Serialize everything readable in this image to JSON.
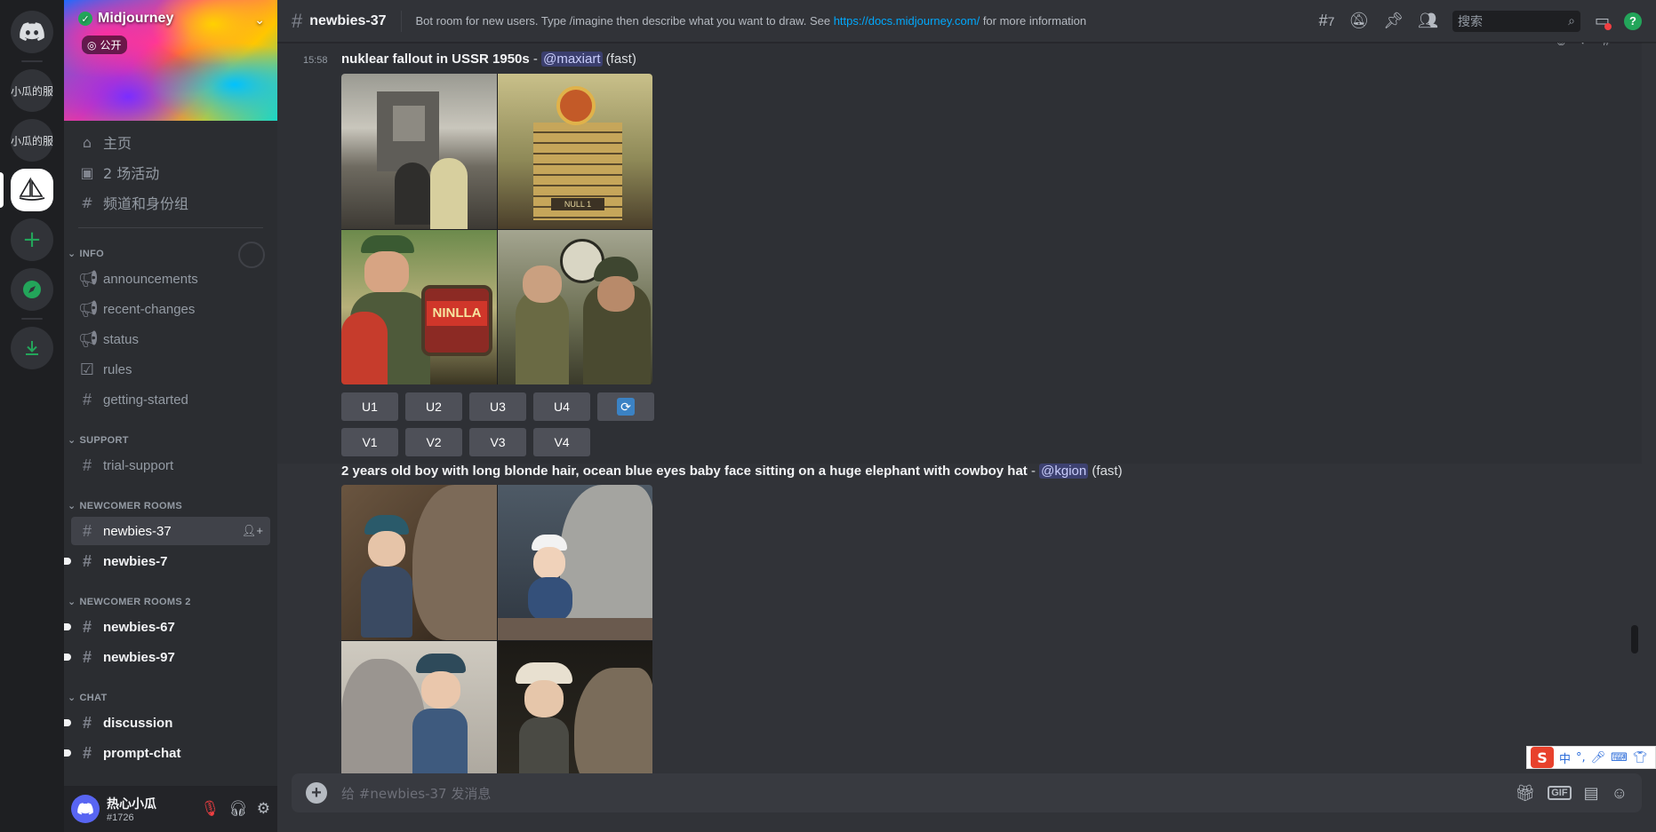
{
  "server_rail": {
    "items": [
      {
        "label": "小瓜的服"
      },
      {
        "label": "小瓜的服"
      }
    ]
  },
  "server": {
    "name": "Midjourney",
    "badge": "公开"
  },
  "nav": [
    {
      "icon": "home-icon",
      "label": "主页"
    },
    {
      "icon": "calendar-icon",
      "label": "2 场活动"
    },
    {
      "icon": "channels-roles-icon",
      "label": "频道和身份组"
    }
  ],
  "categories": {
    "info": "INFO",
    "support": "SUPPORT",
    "newcomer": "NEWCOMER ROOMS",
    "newcomer2": "NEWCOMER ROOMS 2",
    "chat": "CHAT"
  },
  "channels": {
    "info": [
      "announcements",
      "recent-changes",
      "status",
      "rules",
      "getting-started"
    ],
    "support": [
      "trial-support"
    ],
    "newcomer": [
      "newbies-37",
      "newbies-7"
    ],
    "newcomer2": [
      "newbies-67",
      "newbies-97"
    ],
    "chat": [
      "discussion",
      "prompt-chat"
    ]
  },
  "header": {
    "channel": "newbies-37",
    "topic_prefix": "Bot room for new users. Type /imagine then describe what you want to draw. See ",
    "topic_link": "https://docs.midjourney.com/",
    "topic_suffix": " for more information",
    "threads_count": "7",
    "search_placeholder": "搜索"
  },
  "messages": [
    {
      "time": "15:58",
      "prompt": "nuklear fallout in USSR 1950s",
      "sep": " - ",
      "mention": "@maxiart",
      "speed": " (fast)",
      "upscale_buttons": [
        "U1",
        "U2",
        "U3",
        "U4"
      ],
      "variation_buttons": [
        "V1",
        "V2",
        "V3",
        "V4"
      ],
      "sign_text": "NINLLA",
      "building_text": "NULL 1"
    },
    {
      "prompt": "2 years old boy with long blonde hair, ocean blue eyes baby face sitting on a huge elephant with cowboy hat",
      "sep": " - ",
      "mention": "@kgion",
      "speed": " (fast)"
    }
  ],
  "composer": {
    "placeholder": "给 #newbies-37 发消息"
  },
  "user": {
    "name": "热心小瓜",
    "tag": "#1726"
  },
  "ime": {
    "logo": "S",
    "mode": "中"
  },
  "colors": {
    "accent": "#5865f2",
    "online": "#23a55a",
    "link": "#00a8fc",
    "danger": "#f23f42"
  }
}
